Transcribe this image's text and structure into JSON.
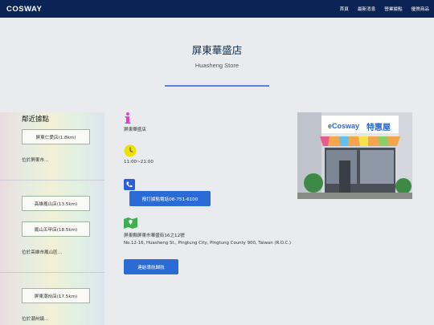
{
  "navbar": {
    "logo": "COSWAY",
    "links": [
      "首頁",
      "最新消息",
      "營業據點",
      "優質商品"
    ]
  },
  "store": {
    "title": "屏東華盛店",
    "subtitle": "Huasheng Store"
  },
  "sidebar": {
    "title": "鄰近據點",
    "locations": [
      {
        "button": "屏東仁愛店(1.8km)",
        "note": "位於屏東市..."
      },
      {
        "button": "高雄鳳山店(13.5km)",
        "note": ""
      },
      {
        "button": "鳳山五甲店(18.5km)",
        "note": "位於高雄市鳳山區..."
      },
      {
        "button": "屏東潮州店(17.5km)",
        "note": "位於潮州鎮..."
      }
    ]
  },
  "details": {
    "name_text": "屏東華盛店",
    "hours_text": "11:00~21:00",
    "phone_button": "撥打據點電話08-751-6100",
    "address_zh": "屏東縣屏東市華盛街16之12號",
    "address_en": "No.12-16, Huasheng St., Pingtung City, Pingtung County 900, Taiwan (R.O.C.)",
    "nav_button": "連結導航歸航"
  },
  "photo": {
    "sign_brand": "eCosway",
    "sign_text": "特惠屋"
  },
  "icons": {
    "info": "info-icon",
    "clock": "clock-icon",
    "phone": "phone-icon",
    "map": "map-icon"
  },
  "colors": {
    "navbar": "#0c2356",
    "accent_button": "#2a6bd6",
    "underline": "#5a7fe0",
    "info_icon": "#e040d8",
    "clock_icon": "#f0e000",
    "phone_icon": "#2b5ed8",
    "map_icon": "#3cb050"
  }
}
